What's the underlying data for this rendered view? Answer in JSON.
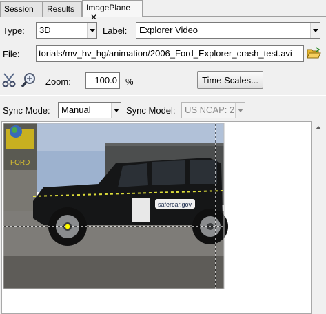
{
  "tabs": [
    {
      "label": "Session"
    },
    {
      "label": "Results"
    },
    {
      "label": "ImagePlane"
    }
  ],
  "close_glyph": "✕",
  "type": {
    "label": "Type:",
    "value": "3D"
  },
  "label": {
    "label": "Label:",
    "value": "Explorer Video"
  },
  "file": {
    "label": "File:",
    "value": "torials/mv_hv_hg/animation/2006_Ford_Explorer_crash_test.avi"
  },
  "zoom": {
    "label": "Zoom:",
    "value": "100.0",
    "unit": "%"
  },
  "time_scales_button": "Time Scales...",
  "sync_mode": {
    "label": "Sync Mode:",
    "value": "Manual"
  },
  "sync_model": {
    "label": "Sync Model:",
    "value": "US NCAP: 2"
  },
  "video": {
    "door_sticker": "safercar.gov",
    "wall_sign": "FORD"
  },
  "icons": [
    "scissors-icon",
    "zoom-icon",
    "folder-open-icon"
  ],
  "colors": {
    "marker": "#ffff00",
    "tab_bg": "#e4e4e4",
    "active_tab_bg": "#f7f7f7"
  }
}
